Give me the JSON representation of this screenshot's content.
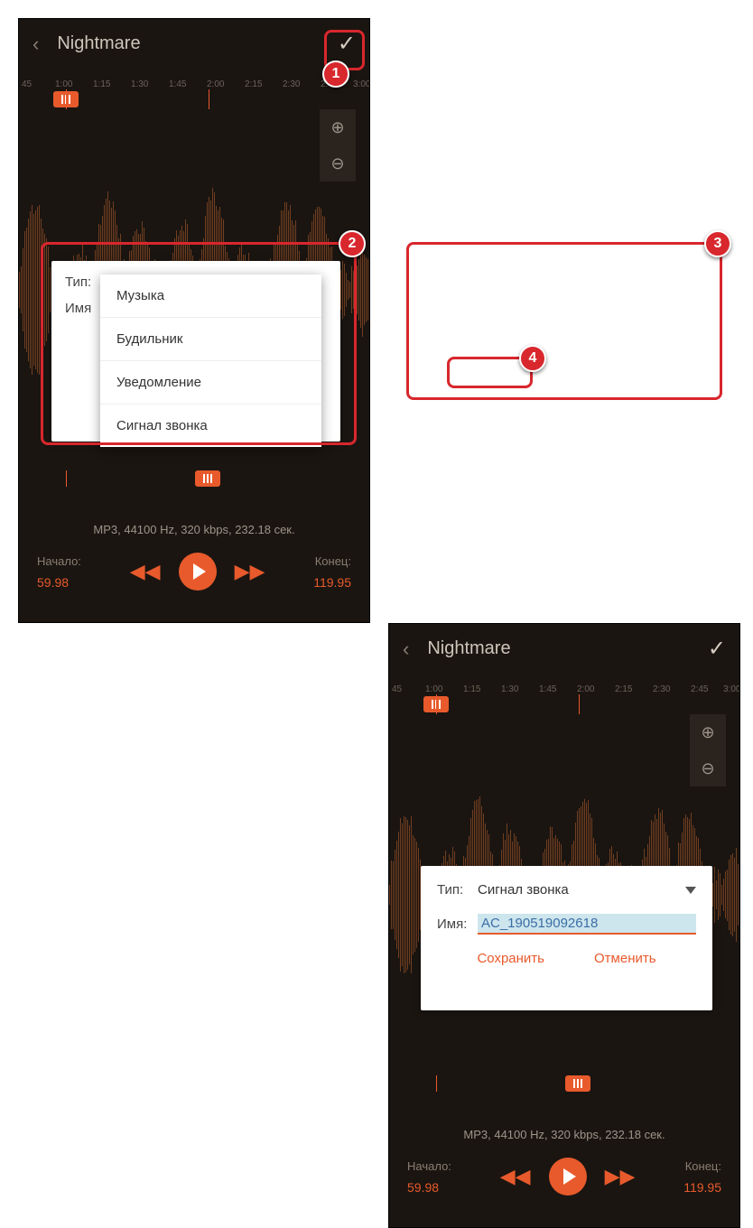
{
  "header": {
    "title": "Nightmare"
  },
  "ruler": {
    "ticks": [
      "45",
      "1:00",
      "1:15",
      "1:30",
      "1:45",
      "2:00",
      "2:15",
      "2:30",
      "2:45",
      "3:00"
    ]
  },
  "info": "MP3, 44100 Hz, 320 kbps, 232.18 сек.",
  "controls": {
    "start_label": "Начало:",
    "start_val": "59.98",
    "end_label": "Конец:",
    "end_val": "119.95"
  },
  "dialog1": {
    "type_label": "Тип:",
    "name_label": "Имя",
    "options": [
      "Музыка",
      "Будильник",
      "Уведомление",
      "Сигнал звонка"
    ]
  },
  "dialog2": {
    "type_label": "Тип:",
    "type_value": "Сигнал звонка",
    "name_label": "Имя:",
    "name_value": "AC_190519092618",
    "save": "Сохранить",
    "cancel": "Отменить"
  },
  "badges": {
    "b1": "1",
    "b2": "2",
    "b3": "3",
    "b4": "4"
  }
}
